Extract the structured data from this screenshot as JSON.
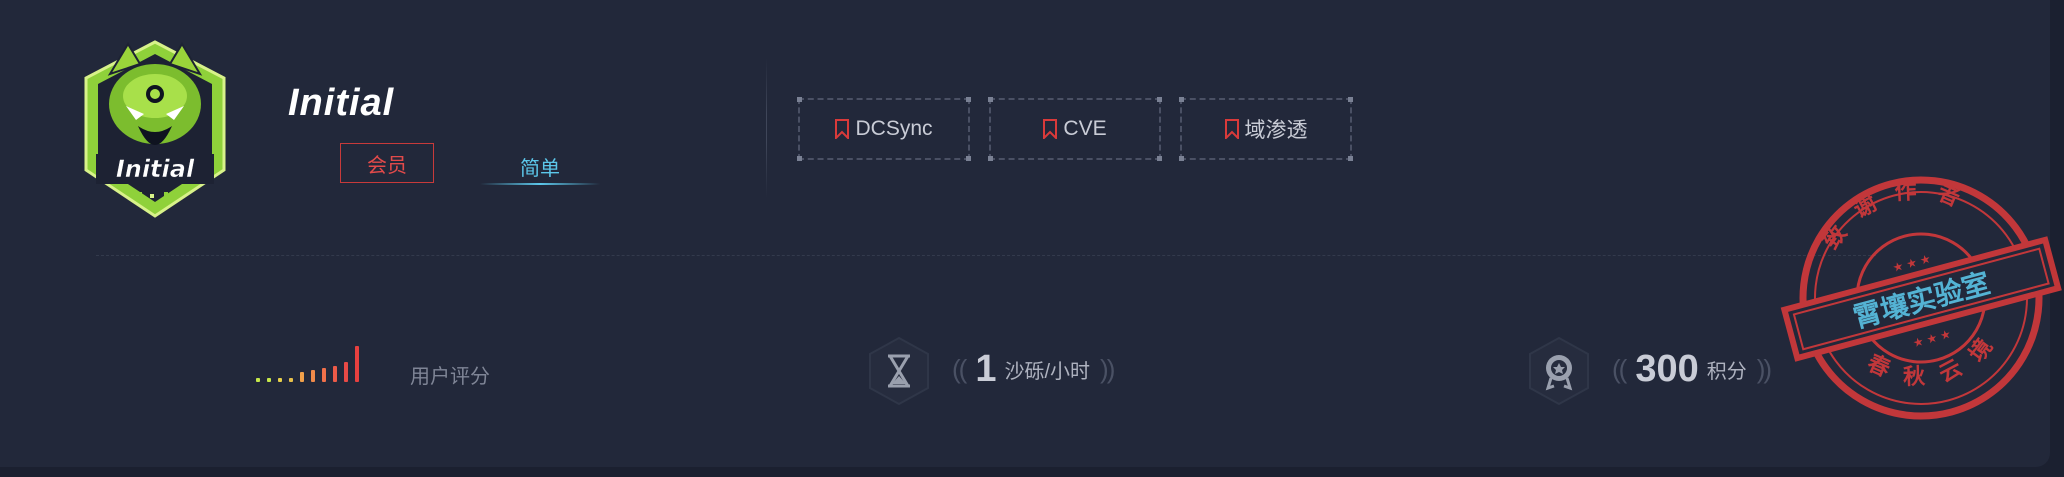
{
  "challenge": {
    "logo_text": "Initial",
    "title": "Initial",
    "member_tag": "会员",
    "difficulty": "简单",
    "keywords": [
      "DCSync",
      "CVE",
      "域渗透"
    ]
  },
  "stats": {
    "rating_label": "用户评分",
    "rating_bars": [
      4,
      4,
      4,
      4,
      10,
      12,
      14,
      16,
      20,
      36
    ],
    "rating_colors": [
      "#c6e84a",
      "#c6e84a",
      "#e8d04a",
      "#e8c04a",
      "#f0a04a",
      "#f08a4a",
      "#f0704a",
      "#ec5a48",
      "#e84a46",
      "#e8403f"
    ],
    "time_value": "1",
    "time_unit": "沙砾/小时",
    "points_value": "300",
    "points_unit": "积分",
    "paren_open": "((",
    "paren_close": "))"
  },
  "stamp": {
    "top_text": "致谢作者",
    "center_text": "霄壤实验室",
    "bottom_text": "春秋云境"
  },
  "colors": {
    "accent_red": "#d93a3a",
    "accent_cyan": "#5cc7ea",
    "background": "#22283a"
  }
}
